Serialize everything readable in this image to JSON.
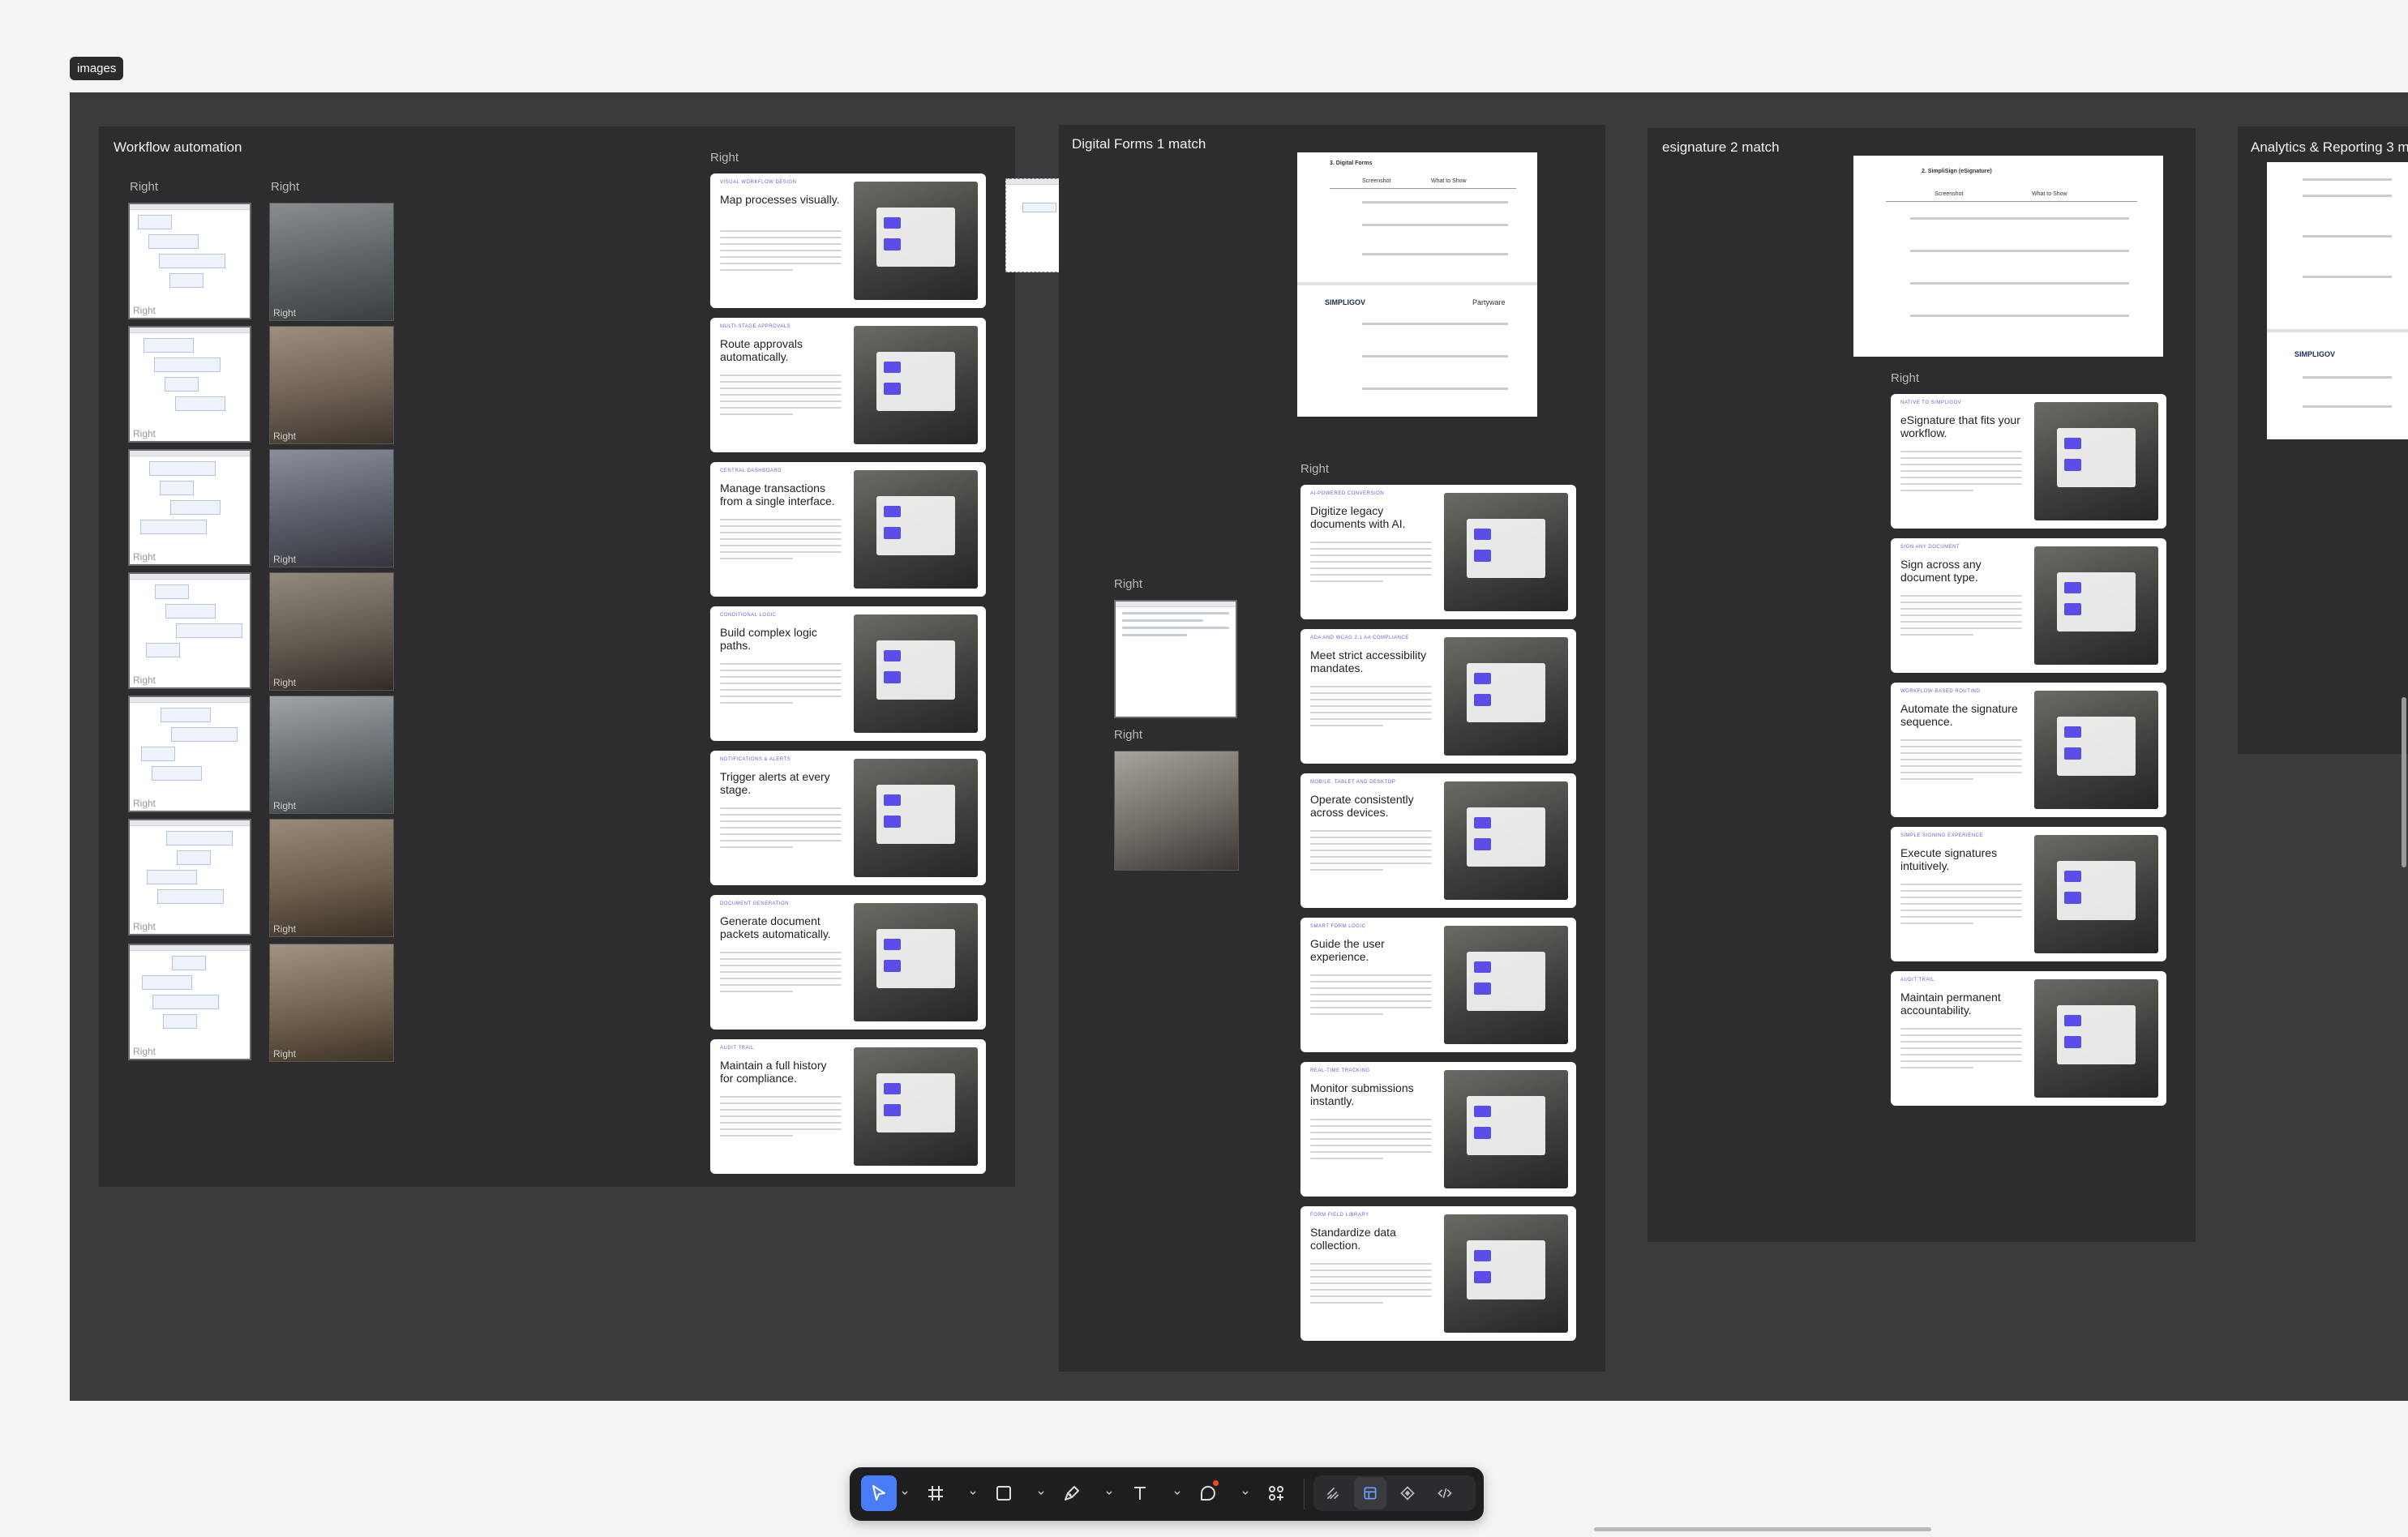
{
  "canvas_tag": "images",
  "sections": {
    "workflow": {
      "title": "Workflow automation",
      "right_label": "Right",
      "thumb_overlay": "Right",
      "cards": [
        {
          "eyebrow": "Visual workflow design",
          "title": "Map processes visually."
        },
        {
          "eyebrow": "Multi-stage approvals",
          "title": "Route approvals automatically."
        },
        {
          "eyebrow": "Central dashboard",
          "title": "Manage transactions from a single interface."
        },
        {
          "eyebrow": "Conditional logic",
          "title": "Build complex logic paths."
        },
        {
          "eyebrow": "Notifications & alerts",
          "title": "Trigger alerts at every stage."
        },
        {
          "eyebrow": "Document generation",
          "title": "Generate document packets automatically."
        },
        {
          "eyebrow": "Audit trail",
          "title": "Maintain a full history for compliance."
        }
      ]
    },
    "forms": {
      "title": "Digital Forms 1 match",
      "right_label": "Right",
      "doc": {
        "heading": "3. Digital Forms",
        "col1": "Screenshot",
        "col2": "What to Show",
        "brand": "SIMPLIGOV",
        "partner": "Partyware"
      },
      "cards": [
        {
          "eyebrow": "AI-powered conversion",
          "title": "Digitize legacy documents with AI."
        },
        {
          "eyebrow": "ADA and WCAG 2.1 AA compliance",
          "title": "Meet strict accessibility mandates."
        },
        {
          "eyebrow": "Mobile, tablet and desktop",
          "title": "Operate consistently across devices."
        },
        {
          "eyebrow": "Smart form logic",
          "title": "Guide the user experience."
        },
        {
          "eyebrow": "Real-time tracking",
          "title": "Monitor submissions instantly."
        },
        {
          "eyebrow": "Form field library",
          "title": "Standardize data collection."
        }
      ]
    },
    "esign": {
      "title": "esignature 2 match",
      "right_label": "Right",
      "doc": {
        "heading": "2. SimpliSign (eSignature)",
        "col1": "Screenshot",
        "col2": "What to Show"
      },
      "cards": [
        {
          "eyebrow": "Native to SimpliGov",
          "title": "eSignature that fits your workflow."
        },
        {
          "eyebrow": "Sign any document",
          "title": "Sign across any document type."
        },
        {
          "eyebrow": "Workflow-based routing",
          "title": "Automate the signature sequence."
        },
        {
          "eyebrow": "Simple signing experience",
          "title": "Execute signatures intuitively."
        },
        {
          "eyebrow": "Audit trail",
          "title": "Maintain permanent accountability."
        }
      ]
    },
    "analytics": {
      "title": "Analytics & Reporting 3 m",
      "brand": "SIMPLIGOV"
    }
  },
  "toolbar": {
    "tools": [
      "move-icon",
      "frame-icon",
      "rectangle-icon",
      "pen-icon",
      "text-icon",
      "comment-icon",
      "components-icon"
    ],
    "right_tools": [
      "draw-icon",
      "design-icon",
      "prototype-icon",
      "dev-mode-icon"
    ],
    "accent": "#4a7cf7"
  }
}
